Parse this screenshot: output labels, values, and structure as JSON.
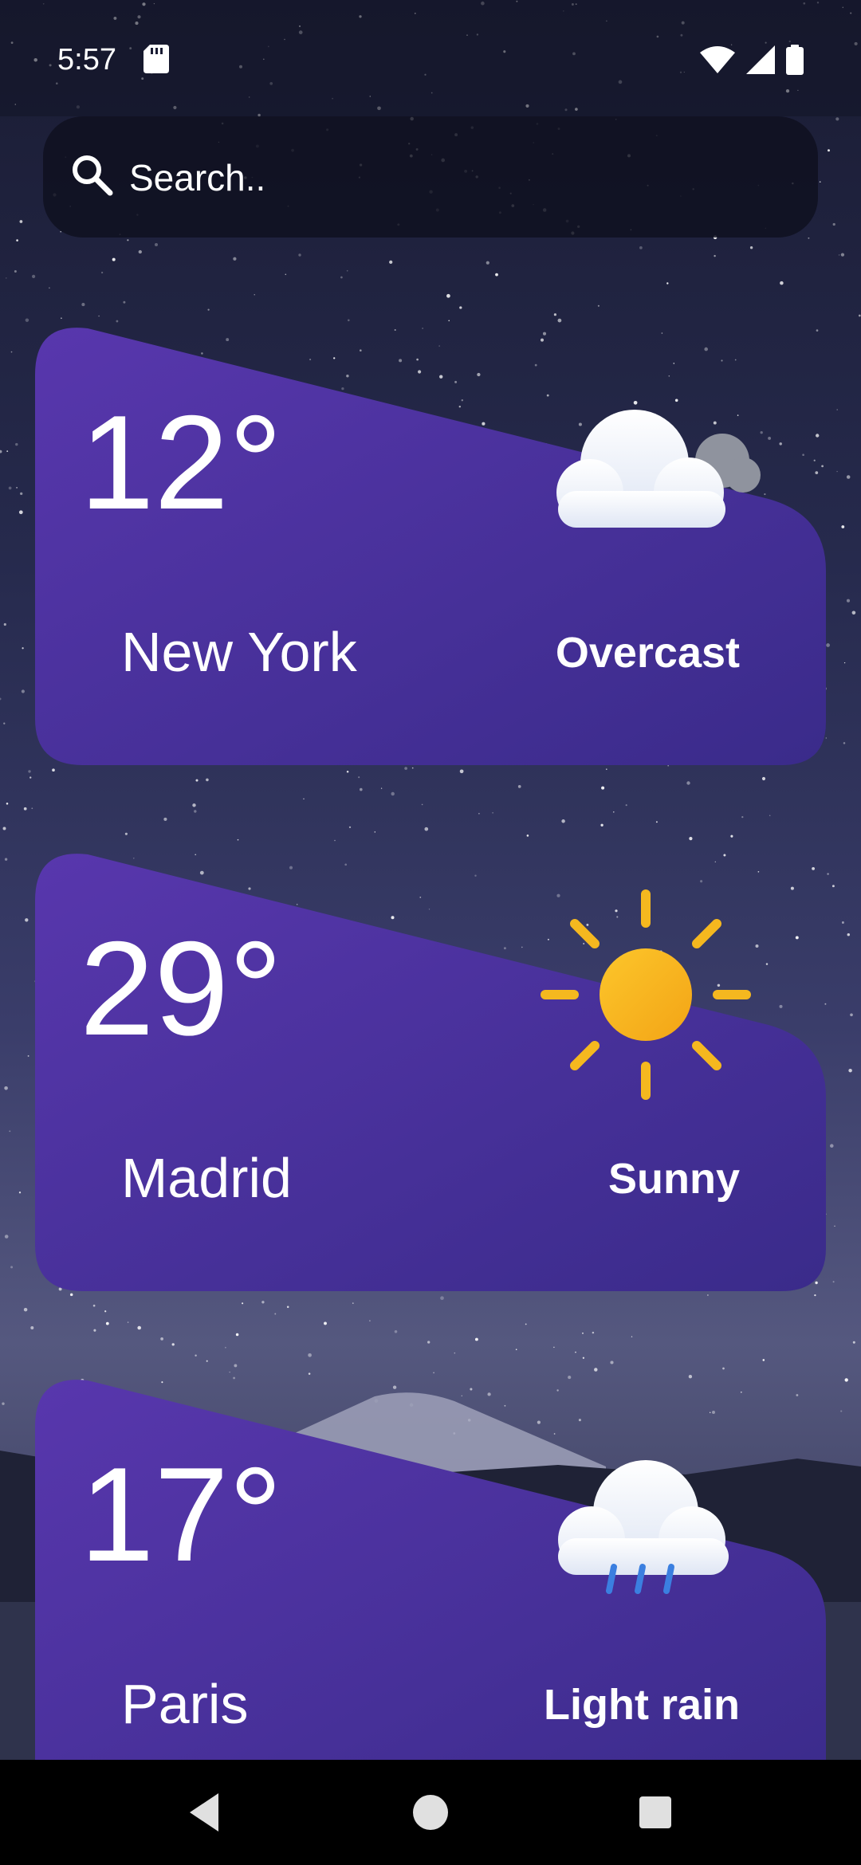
{
  "status_bar": {
    "time": "5:57"
  },
  "search": {
    "placeholder": "Search.."
  },
  "cards": [
    {
      "temperature": "12°",
      "city": "New York",
      "condition": "Overcast",
      "icon": "overcast-cloud-icon"
    },
    {
      "temperature": "29°",
      "city": "Madrid",
      "condition": "Sunny",
      "icon": "sun-icon"
    },
    {
      "temperature": "17°",
      "city": "Paris",
      "condition": "Light rain",
      "icon": "rain-cloud-icon"
    }
  ],
  "colors": {
    "card_start": "#5837ad",
    "card_end": "#3a2b8a",
    "sun": "#f5b81f",
    "rain": "#3b7fe0"
  }
}
